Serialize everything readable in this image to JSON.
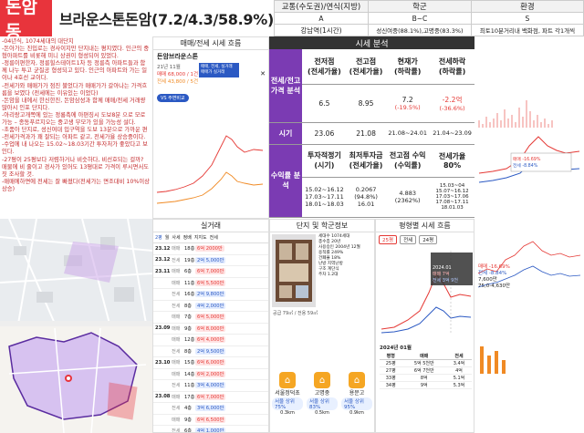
{
  "title": {
    "district": "돈암동",
    "apt": "브라운스톤돈암(7.2/4.3/58.9%)"
  },
  "info_table": {
    "headers": [
      "교통(수도권)/연식(지방)",
      "학군",
      "환경"
    ],
    "grades": [
      "A",
      "B~C",
      "S"
    ],
    "details": [
      "강남역(1시간)",
      "성신여중(88.1%),고명중(83.3%)",
      "최토10분거리내 백화점, 파트 각1개씩"
    ]
  },
  "notes": [
    "-04년식, 1074세대의 대단지",
    "-돈아가는 진입로는 경사이지만 단지내는 평지였다. 인근의 중형아파트를 비롯해 미니 상권이 형성되어 있었다.",
    "-정릉이편한자, 정릉힐스테이트1차 등 정릉측 아파트들과 함께 나누 투고 균질공 형성되고 있다. 인근의 아파트와 가는 일이나 4호선 교이다.",
    "-전세가와 매매가가 점진 불었다가 매매가가 갈아나는 가격흐름을 보였다 (전세에는 이유있는 이었다)",
    "-돈암을 내에서 한신한진, 돈암삼성과 함께 매매/전세 거래량 많아시 인포 단지다.",
    "-아리랑고개쪽에 있는 정룡촉에 아편징시 도보8분 으로 모로 가능 – 종동푸르지오는 중고생 부모가 있을 가능성 설다.",
    "-초품아 단지로, 성신여대 입구역을 도보 13분으로 가까운 편",
    "-전세가격과가 꽤 잘되는 아파트 같고, 전세가율 상승중이다.",
    "-수업에 내 나오는 15.02~18.03기간 투자처가 좋았다고 보인다.",
    "-27평이 25평보다 저렴하거나 비슷하다, 비선호되는 걸까? 매물에 비 줄이고 경사가 있어도 13평대로 가격이 루시면서도 짓 조사할 것.",
    "-매매에하면에 전세는 잘 빠졌다(전세가는 면조대비 10%이상 상승)"
  ],
  "trade": {
    "header": "매매/전세 시세 흐름",
    "apt": "돈암브라운스톤",
    "tooltip_label": "21년 11월",
    "sale_price": "매매 68,000 / 1건",
    "rent_price": "전세 43,800 / 5건",
    "compare": "VS 주변비교",
    "chart_labels": [
      "매매, 전세, 실거래",
      "매매가 실거래"
    ]
  },
  "analysis": {
    "header": "시세 분석",
    "row1_side": "전세/전고가격 분석",
    "row1_heads": [
      "전저점\n(전세가율)",
      "전고점\n(전세가율)",
      "현재가\n(하락률)",
      "전세하락\n(하락률)"
    ],
    "row1_vals": [
      "6.5",
      "8.95",
      "7.2",
      "-2.2억"
    ],
    "row1_sub": [
      "",
      "",
      "(-19.5%)",
      "(-36.6%)"
    ],
    "row2_side": "시기",
    "row2_vals": [
      "23.06",
      "21.08",
      "21.08~24.01",
      "21.04~23.09"
    ],
    "row3_side": "수익률 분석",
    "row3_heads": [
      "투자적정기\n(시기)",
      "최저투자금\n(전세가율)",
      "전고점 수익\n(수익률)",
      "전세가율\n80%"
    ],
    "row3_vals": [
      "15.02~16.12\n17.03~17.11\n18.01~18.03",
      "0.2067\n(94.8%)\n16.01",
      "4.883\n(2362%)",
      "15.03~04\n15.07~16.12\n17.03~17.06\n17.08~17.11\n18.01.03"
    ]
  },
  "rchart": {
    "legend_sale": "매매 -16.69%",
    "legend_rent": "전세 -8.84%",
    "price1": "7,600만",
    "price2": "75,0-4,630만"
  },
  "real": {
    "header": "실거래",
    "tabs": [
      "2평",
      "월",
      "사세",
      "정배",
      "지지도",
      "전세"
    ],
    "rows": [
      {
        "date": "23.12",
        "type": "매매",
        "floor": "18층",
        "price": "6억 2000만",
        "kind": "sale"
      },
      {
        "date": "23.12",
        "type": "전세",
        "floor": "19층",
        "price": "2억 5,000만",
        "kind": "rent"
      },
      {
        "date": "23.11",
        "type": "매매",
        "floor": "6층",
        "price": "6억 7,000만",
        "kind": "sale"
      },
      {
        "date": "",
        "type": "매매",
        "floor": "11층",
        "price": "6억 5,500만",
        "kind": "sale"
      },
      {
        "date": "",
        "type": "전세",
        "floor": "16층",
        "price": "2억 9,800만",
        "kind": "rent"
      },
      {
        "date": "",
        "type": "전세",
        "floor": "8층",
        "price": "4억 2,000만",
        "kind": "rent"
      },
      {
        "date": "",
        "type": "매매",
        "floor": "7층",
        "price": "6억 5,000만",
        "kind": "sale"
      },
      {
        "date": "23.09",
        "type": "매매",
        "floor": "9층",
        "price": "6억 8,000만",
        "kind": "sale"
      },
      {
        "date": "",
        "type": "매매",
        "floor": "12층",
        "price": "6억 4,000만",
        "kind": "sale"
      },
      {
        "date": "",
        "type": "전세",
        "floor": "8층",
        "price": "2억 9,500만",
        "kind": "rent"
      },
      {
        "date": "23.10",
        "type": "매매",
        "floor": "15층",
        "price": "6억 6,000만",
        "kind": "sale"
      },
      {
        "date": "",
        "type": "매매",
        "floor": "14층",
        "price": "6억 2,000만",
        "kind": "sale"
      },
      {
        "date": "",
        "type": "전세",
        "floor": "11층",
        "price": "3억 4,000만",
        "kind": "rent"
      },
      {
        "date": "23.08",
        "type": "매매",
        "floor": "17층",
        "price": "6억 7,000만",
        "kind": "sale"
      },
      {
        "date": "",
        "type": "전세",
        "floor": "4층",
        "price": "3억 6,000만",
        "kind": "rent"
      },
      {
        "date": "",
        "type": "매매",
        "floor": "9층",
        "price": "6억 6,500만",
        "kind": "sale"
      },
      {
        "date": "",
        "type": "전세",
        "floor": "6층",
        "price": "4억 1,000만",
        "kind": "rent"
      },
      {
        "date": "23.07",
        "type": "매매",
        "floor": "3층",
        "price": "6억 2,000만",
        "kind": "sale"
      }
    ]
  },
  "school": {
    "header": "단지 및 학군정보",
    "info": [
      "세대수",
      "1074세대",
      "총수층",
      "20년",
      "사용승인",
      "2004년 12월",
      "용적률",
      "249%",
      "건폐율",
      "18%",
      "난방",
      "지역난방",
      "구조",
      "계단식",
      "주차",
      "1.2대"
    ],
    "floorplan": "공급 79㎡ / 전용 59㎡",
    "schools": [
      {
        "name": "서울정덕초",
        "rate": "서울 상위 75%",
        "dist": "0.3km"
      },
      {
        "name": "고명중",
        "rate": "서울 상위 83%",
        "dist": "0.5km"
      },
      {
        "name": "용문고",
        "rate": "서울 상위 95%",
        "dist": "0.9km"
      }
    ]
  },
  "price": {
    "header": "평형별 시세 흐름",
    "buttons": [
      "25평",
      "전세",
      "24평"
    ],
    "date": "2024년 01월",
    "tip": [
      "2024.01",
      "매매 7억",
      "전세 3억 9천"
    ],
    "table_head": [
      "평형",
      "매매",
      "전세"
    ],
    "table_rows": [
      [
        "25평",
        "5억 5천만",
        "3.4억"
      ],
      [
        "27평",
        "6억 7천만",
        "4억"
      ],
      [
        "33평",
        "8억",
        "5.1억"
      ],
      [
        "34평",
        "9억",
        "5.3억"
      ]
    ]
  },
  "colors": {
    "red": "#e8343c",
    "purple": "#7b3bb3",
    "dark": "#333333",
    "blue": "#2b59c3",
    "orange": "#f5a623"
  }
}
